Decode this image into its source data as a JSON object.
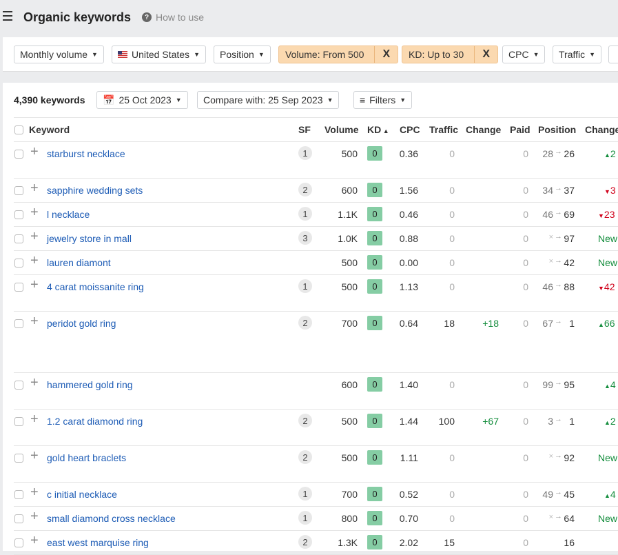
{
  "header": {
    "title": "Organic keywords",
    "how_to_use": "How to use"
  },
  "filters": {
    "monthly_volume": "Monthly volume",
    "country": "United States",
    "position": "Position",
    "volume": "Volume: From 500",
    "kd": "KD: Up to 30",
    "cpc": "CPC",
    "traffic": "Traffic",
    "close_glyph": "X"
  },
  "toolbar": {
    "count": "4,390 keywords",
    "date": "25 Oct 2023",
    "compare": "Compare with: 25 Sep 2023",
    "filters": "Filters"
  },
  "columns": {
    "keyword": "Keyword",
    "sf": "SF",
    "volume": "Volume",
    "kd": "KD",
    "cpc": "CPC",
    "traffic": "Traffic",
    "change": "Change",
    "paid": "Paid",
    "position": "Position",
    "pos_change": "Change"
  },
  "colors": {
    "accent_link": "#1c5bb5",
    "kd_green": "#85cda4",
    "active_filter": "#fbd9b0",
    "up": "#128c3b",
    "down": "#d0021b"
  },
  "rows": [
    {
      "keyword": "starburst necklace",
      "sf": "1",
      "volume": "500",
      "kd": "0",
      "cpc": "0.36",
      "traffic": "0",
      "change": "",
      "paid": "0",
      "pos_from": "28",
      "pos_to": "26",
      "pos_change": "2",
      "dir": "up"
    },
    {
      "keyword": "sapphire wedding sets",
      "sf": "2",
      "volume": "600",
      "kd": "0",
      "cpc": "1.56",
      "traffic": "0",
      "change": "",
      "paid": "0",
      "pos_from": "34",
      "pos_to": "37",
      "pos_change": "3",
      "dir": "down"
    },
    {
      "keyword": "l necklace",
      "sf": "1",
      "volume": "1.1K",
      "kd": "0",
      "cpc": "0.46",
      "traffic": "0",
      "change": "",
      "paid": "0",
      "pos_from": "46",
      "pos_to": "69",
      "pos_change": "23",
      "dir": "down"
    },
    {
      "keyword": "jewelry store in mall",
      "sf": "3",
      "volume": "1.0K",
      "kd": "0",
      "cpc": "0.88",
      "traffic": "0",
      "change": "",
      "paid": "0",
      "pos_from": "×",
      "pos_to": "97",
      "pos_change": "New",
      "dir": "new"
    },
    {
      "keyword": "lauren diamont",
      "sf": "",
      "volume": "500",
      "kd": "0",
      "cpc": "0.00",
      "traffic": "0",
      "change": "",
      "paid": "0",
      "pos_from": "×",
      "pos_to": "42",
      "pos_change": "New",
      "dir": "new"
    },
    {
      "keyword": "4 carat moissanite ring",
      "sf": "1",
      "volume": "500",
      "kd": "0",
      "cpc": "1.13",
      "traffic": "0",
      "change": "",
      "paid": "0",
      "pos_from": "46",
      "pos_to": "88",
      "pos_change": "42",
      "dir": "down"
    },
    {
      "keyword": "peridot gold ring",
      "sf": "2",
      "volume": "700",
      "kd": "0",
      "cpc": "0.64",
      "traffic": "18",
      "change": "+18",
      "paid": "0",
      "pos_from": "67",
      "pos_to": "1",
      "pos_change": "66",
      "dir": "up"
    },
    {
      "keyword": "hammered gold ring",
      "sf": "",
      "volume": "600",
      "kd": "0",
      "cpc": "1.40",
      "traffic": "0",
      "change": "",
      "paid": "0",
      "pos_from": "99",
      "pos_to": "95",
      "pos_change": "4",
      "dir": "up"
    },
    {
      "keyword": "1.2 carat diamond ring",
      "sf": "2",
      "volume": "500",
      "kd": "0",
      "cpc": "1.44",
      "traffic": "100",
      "change": "+67",
      "paid": "0",
      "pos_from": "3",
      "pos_to": "1",
      "pos_change": "2",
      "dir": "up"
    },
    {
      "keyword": "gold heart braclets",
      "sf": "2",
      "volume": "500",
      "kd": "0",
      "cpc": "1.11",
      "traffic": "0",
      "change": "",
      "paid": "0",
      "pos_from": "×",
      "pos_to": "92",
      "pos_change": "New",
      "dir": "new"
    },
    {
      "keyword": "c initial necklace",
      "sf": "1",
      "volume": "700",
      "kd": "0",
      "cpc": "0.52",
      "traffic": "0",
      "change": "",
      "paid": "0",
      "pos_from": "49",
      "pos_to": "45",
      "pos_change": "4",
      "dir": "up"
    },
    {
      "keyword": "small diamond cross necklace",
      "sf": "1",
      "volume": "800",
      "kd": "0",
      "cpc": "0.70",
      "traffic": "0",
      "change": "",
      "paid": "0",
      "pos_from": "×",
      "pos_to": "64",
      "pos_change": "New",
      "dir": "new"
    },
    {
      "keyword": "east west marquise ring",
      "sf": "2",
      "volume": "1.3K",
      "kd": "0",
      "cpc": "2.02",
      "traffic": "15",
      "change": "",
      "paid": "0",
      "pos_from": "",
      "pos_to": "16",
      "pos_change": "",
      "dir": ""
    }
  ]
}
